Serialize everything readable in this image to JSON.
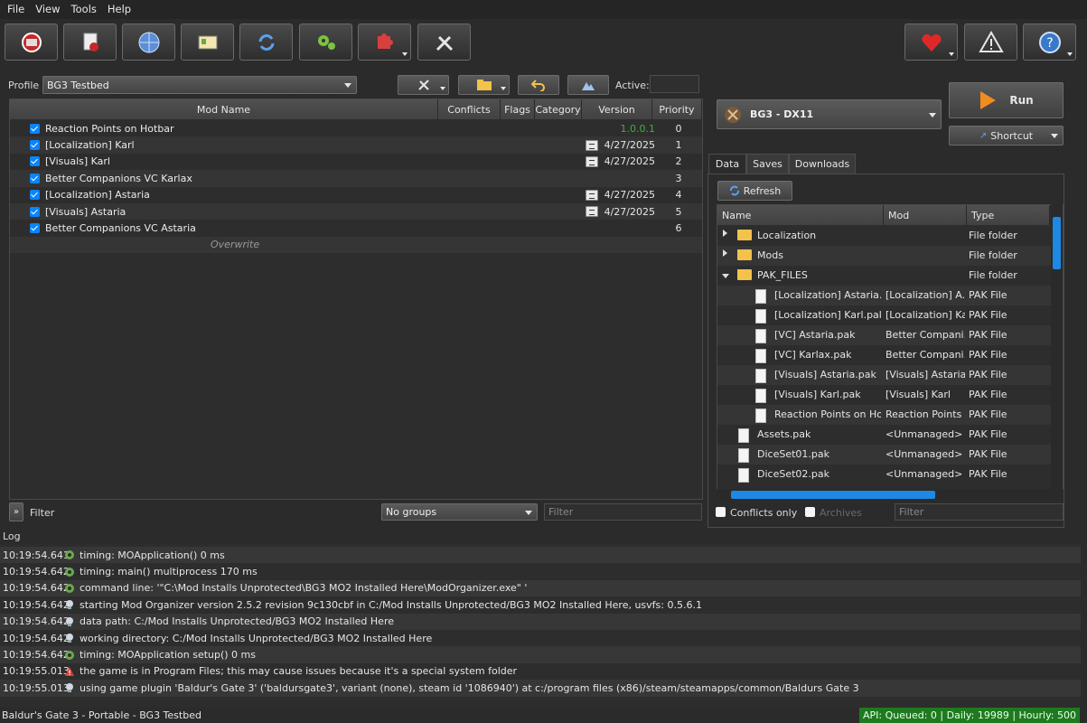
{
  "menu": [
    "File",
    "View",
    "Tools",
    "Help"
  ],
  "toolbar": {
    "buttons": [
      "change-game",
      "install-mod",
      "nexus",
      "profiles",
      "refresh",
      "settings",
      "plugins",
      "tools"
    ],
    "right_buttons": [
      "endorse",
      "problems",
      "help"
    ]
  },
  "profile": {
    "label": "Profile",
    "value": "BG3 Testbed",
    "active_label": "Active:"
  },
  "modlist": {
    "columns": [
      "Mod Name",
      "Conflicts",
      "Flags",
      "Category",
      "Version",
      "Priority"
    ],
    "rows": [
      {
        "name": "Reaction Points on Hotbar",
        "version": "1.0.0.1",
        "priority": "0",
        "flag": false
      },
      {
        "name": "[Localization] Karl",
        "version": "4/27/2025",
        "priority": "1",
        "flag": true
      },
      {
        "name": "[Visuals] Karl",
        "version": "4/27/2025",
        "priority": "2",
        "flag": true
      },
      {
        "name": "Better Companions VC Karlax",
        "version": "",
        "priority": "3",
        "flag": false
      },
      {
        "name": "[Localization] Astaria",
        "version": "4/27/2025",
        "priority": "4",
        "flag": true
      },
      {
        "name": "[Visuals] Astaria",
        "version": "4/27/2025",
        "priority": "5",
        "flag": true
      },
      {
        "name": "Better Companions VC Astaria",
        "version": "",
        "priority": "6",
        "flag": false
      }
    ],
    "overwrite": "Overwrite"
  },
  "bottom_left": {
    "filter_label": "Filter",
    "groups": "No groups",
    "filter_placeholder": "Filter"
  },
  "executable": {
    "name": "BG3 - DX11",
    "run": "Run",
    "shortcut": "Shortcut"
  },
  "tabs": [
    "Data",
    "Saves",
    "Downloads"
  ],
  "data_tab": {
    "refresh": "Refresh",
    "columns": [
      "Name",
      "Mod",
      "Type"
    ],
    "rows": [
      {
        "name": "Localization",
        "mod": "",
        "type": "File folder",
        "kind": "folder",
        "indent": 0,
        "expander": "closed"
      },
      {
        "name": "Mods",
        "mod": "",
        "type": "File folder",
        "kind": "folder",
        "indent": 0,
        "expander": "closed"
      },
      {
        "name": "PAK_FILES",
        "mod": "",
        "type": "File folder",
        "kind": "folder",
        "indent": 0,
        "expander": "open"
      },
      {
        "name": "[Localization] Astaria.p...",
        "mod": "[Localization] A...",
        "type": "PAK File",
        "kind": "file",
        "indent": 1
      },
      {
        "name": "[Localization] Karl.pak",
        "mod": "[Localization] Karl",
        "type": "PAK File",
        "kind": "file",
        "indent": 1
      },
      {
        "name": "[VC] Astaria.pak",
        "mod": "Better Compani...",
        "type": "PAK File",
        "kind": "file",
        "indent": 1
      },
      {
        "name": "[VC] Karlax.pak",
        "mod": "Better Compani...",
        "type": "PAK File",
        "kind": "file",
        "indent": 1
      },
      {
        "name": "[Visuals] Astaria.pak",
        "mod": "[Visuals] Astaria",
        "type": "PAK File",
        "kind": "file",
        "indent": 1
      },
      {
        "name": "[Visuals] Karl.pak",
        "mod": "[Visuals] Karl",
        "type": "PAK File",
        "kind": "file",
        "indent": 1
      },
      {
        "name": "Reaction Points on Ho...",
        "mod": "Reaction Points ...",
        "type": "PAK File",
        "kind": "file",
        "indent": 1
      },
      {
        "name": "Assets.pak",
        "mod": "<Unmanaged>",
        "type": "PAK File",
        "kind": "file",
        "indent": 0
      },
      {
        "name": "DiceSet01.pak",
        "mod": "<Unmanaged>",
        "type": "PAK File",
        "kind": "file",
        "indent": 0
      },
      {
        "name": "DiceSet02.pak",
        "mod": "<Unmanaged>",
        "type": "PAK File",
        "kind": "file",
        "indent": 0
      }
    ],
    "conflicts_only": "Conflicts only",
    "archives": "Archives",
    "filter_placeholder": "Filter"
  },
  "log": {
    "title": "Log",
    "rows": [
      {
        "time": "10:19:54.641",
        "icon": "debug",
        "msg": "timing: MOApplication() 0 ms"
      },
      {
        "time": "10:19:54.642",
        "icon": "debug",
        "msg": "timing: main() multiprocess 170 ms"
      },
      {
        "time": "10:19:54.642",
        "icon": "debug",
        "msg": "command line: '\"C:\\Mod Installs Unprotected\\BG3 MO2 Installed Here\\ModOrganizer.exe\" '"
      },
      {
        "time": "10:19:54.642",
        "icon": "info",
        "msg": "starting Mod Organizer version 2.5.2 revision 9c130cbf in C:/Mod Installs Unprotected/BG3 MO2 Installed Here, usvfs: 0.5.6.1"
      },
      {
        "time": "10:19:54.642",
        "icon": "info",
        "msg": "data path: C:/Mod Installs Unprotected/BG3 MO2 Installed Here"
      },
      {
        "time": "10:19:54.642",
        "icon": "info",
        "msg": "working directory: C:/Mod Installs Unprotected/BG3 MO2 Installed Here"
      },
      {
        "time": "10:19:54.642",
        "icon": "debug",
        "msg": "timing: MOApplication setup() 0 ms"
      },
      {
        "time": "10:19:55.013",
        "icon": "warning",
        "msg": "the game is in Program Files; this may cause issues because it's a special system folder"
      },
      {
        "time": "10:19:55.013",
        "icon": "info",
        "msg": "using game plugin 'Baldur's Gate 3' ('baldursgate3', variant (none), steam id '1086940') at c:/program files (x86)/steam/steamapps/common/Baldurs Gate 3"
      }
    ]
  },
  "status": {
    "left": "Baldur's Gate 3 - Portable - BG3 Testbed",
    "api": "API: Queued: 0 | Daily: 19989 | Hourly: 500"
  },
  "colors": {
    "accent": "#0a84ff",
    "api_bg": "#1f7a1f",
    "version_ok": "#3fae3f"
  }
}
